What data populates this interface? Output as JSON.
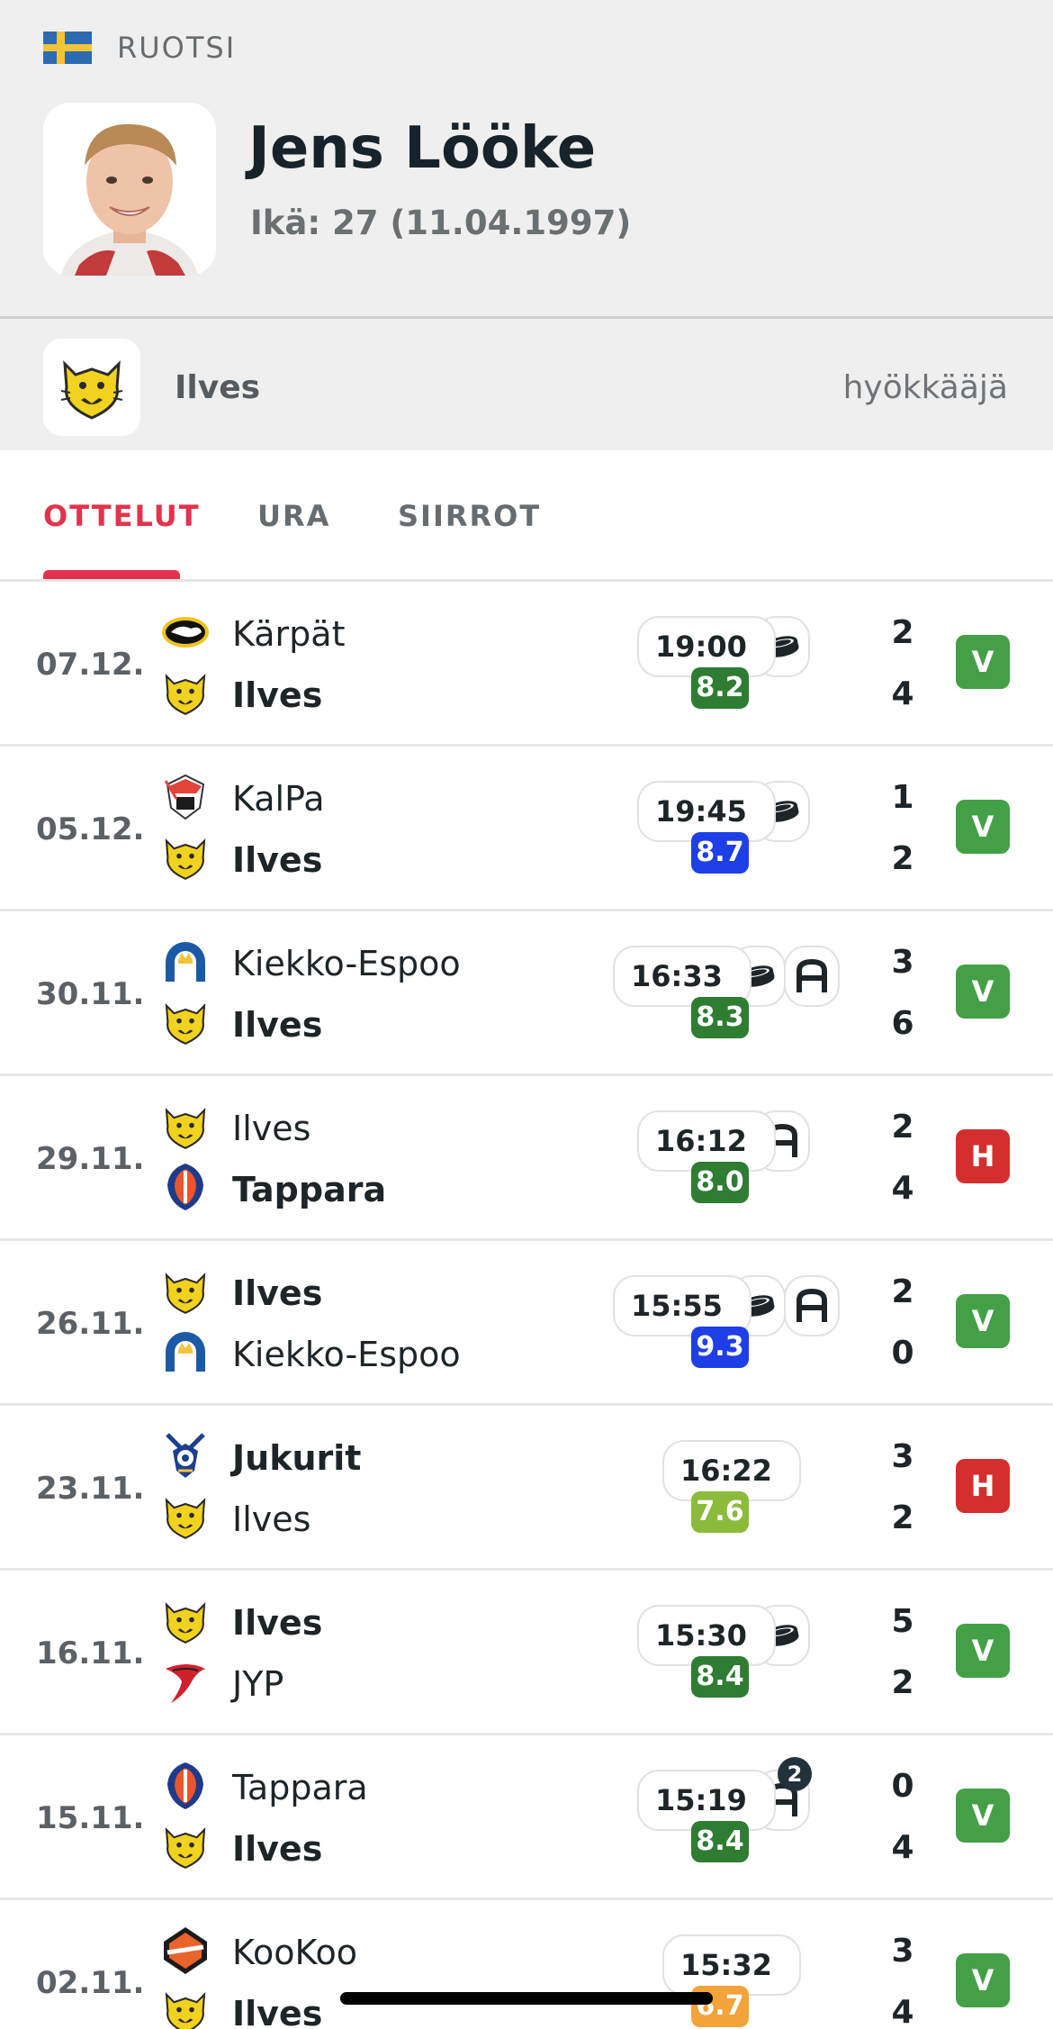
{
  "player": {
    "country": "RUOTSI",
    "name": "Jens Lööke",
    "age": "Ikä: 27 (11.04.1997)",
    "team": "Ilves",
    "position": "hyökkääjä"
  },
  "tabs": [
    {
      "label": "OTTELUT",
      "active": true
    },
    {
      "label": "URA",
      "active": false
    },
    {
      "label": "SIIRROT",
      "active": false
    }
  ],
  "colors": {
    "accent": "#e2334d",
    "win": "#43a047",
    "loss": "#d32f2f",
    "rating_dark_green": "#2e7d32",
    "rating_blue": "#1e3ee6",
    "rating_light_green": "#8bbb3a",
    "rating_orange": "#f2a33a"
  },
  "matches": [
    {
      "date": "07.12.",
      "home": "Kärpät",
      "away": "Ilves",
      "home_bold": false,
      "away_bold": true,
      "time": "19:00",
      "icons": [
        "puck-icon"
      ],
      "rating": "8.2",
      "rating_color": "#2e7d32",
      "home_score": "2",
      "away_score": "4",
      "result": "V",
      "home_logo": "karpat",
      "away_logo": "ilves"
    },
    {
      "date": "05.12.",
      "home": "KalPa",
      "away": "Ilves",
      "home_bold": false,
      "away_bold": true,
      "time": "19:45",
      "icons": [
        "puck-icon"
      ],
      "rating": "8.7",
      "rating_color": "#1e3ee6",
      "home_score": "1",
      "away_score": "2",
      "result": "V",
      "home_logo": "kalpa",
      "away_logo": "ilves"
    },
    {
      "date": "30.11.",
      "home": "Kiekko-Espoo",
      "away": "Ilves",
      "home_bold": false,
      "away_bold": true,
      "time": "16:33",
      "icons": [
        "puck-icon",
        "assist-icon"
      ],
      "rating": "8.3",
      "rating_color": "#2e7d32",
      "home_score": "3",
      "away_score": "6",
      "result": "V",
      "home_logo": "kiekko",
      "away_logo": "ilves"
    },
    {
      "date": "29.11.",
      "home": "Ilves",
      "away": "Tappara",
      "home_bold": false,
      "away_bold": true,
      "time": "16:12",
      "icons": [
        "assist-icon"
      ],
      "rating": "8.0",
      "rating_color": "#2e7d32",
      "home_score": "2",
      "away_score": "4",
      "result": "H",
      "home_logo": "ilves",
      "away_logo": "tappara"
    },
    {
      "date": "26.11.",
      "home": "Ilves",
      "away": "Kiekko-Espoo",
      "home_bold": true,
      "away_bold": false,
      "time": "15:55",
      "icons": [
        "puck-icon",
        "assist-icon"
      ],
      "rating": "9.3",
      "rating_color": "#1e3ee6",
      "home_score": "2",
      "away_score": "0",
      "result": "V",
      "home_logo": "ilves",
      "away_logo": "kiekko"
    },
    {
      "date": "23.11.",
      "home": "Jukurit",
      "away": "Ilves",
      "home_bold": true,
      "away_bold": false,
      "time": "16:22",
      "icons": [],
      "rating": "7.6",
      "rating_color": "#8bbb3a",
      "home_score": "3",
      "away_score": "2",
      "result": "H",
      "home_logo": "jukurit",
      "away_logo": "ilves"
    },
    {
      "date": "16.11.",
      "home": "Ilves",
      "away": "JYP",
      "home_bold": true,
      "away_bold": false,
      "time": "15:30",
      "icons": [
        "puck-icon"
      ],
      "rating": "8.4",
      "rating_color": "#2e7d32",
      "home_score": "5",
      "away_score": "2",
      "result": "V",
      "home_logo": "ilves",
      "away_logo": "jyp"
    },
    {
      "date": "15.11.",
      "home": "Tappara",
      "away": "Ilves",
      "home_bold": false,
      "away_bold": true,
      "time": "15:19",
      "icons": [
        "assist-icon"
      ],
      "assist_badge": "2",
      "rating": "8.4",
      "rating_color": "#2e7d32",
      "home_score": "0",
      "away_score": "4",
      "result": "V",
      "home_logo": "tappara",
      "away_logo": "ilves"
    },
    {
      "date": "02.11.",
      "home": "KooKoo",
      "away": "Ilves",
      "home_bold": false,
      "away_bold": true,
      "time": "15:32",
      "icons": [],
      "rating": "6.7",
      "rating_color": "#f2a33a",
      "home_score": "3",
      "away_score": "4",
      "result": "V",
      "home_logo": "kookoo",
      "away_logo": "ilves"
    }
  ]
}
